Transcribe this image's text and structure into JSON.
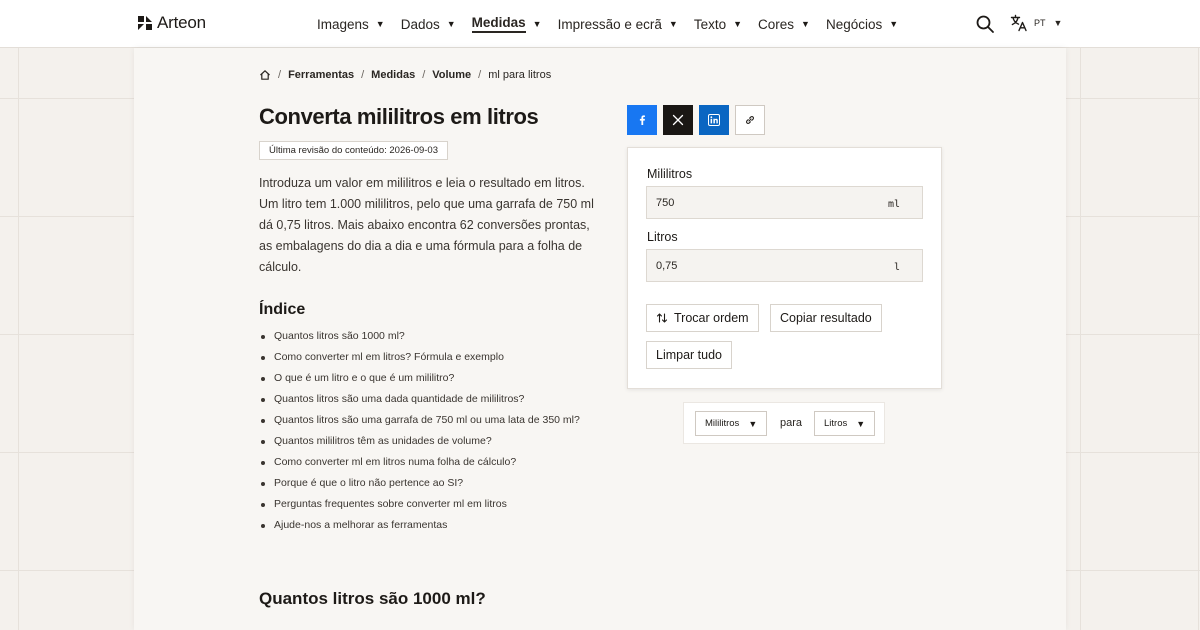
{
  "header": {
    "logo_text": "Arteon",
    "nav": [
      {
        "label": "Imagens",
        "active": false
      },
      {
        "label": "Dados",
        "active": false
      },
      {
        "label": "Medidas",
        "active": true
      },
      {
        "label": "Impressão e ecrã",
        "active": false
      },
      {
        "label": "Texto",
        "active": false
      },
      {
        "label": "Cores",
        "active": false
      },
      {
        "label": "Negócios",
        "active": false
      }
    ],
    "language": "PT",
    "caret": "▼"
  },
  "breadcrumb": {
    "items": [
      "Ferramentas",
      "Medidas",
      "Volume"
    ],
    "current": "ml para litros",
    "separator": "/"
  },
  "article": {
    "title": "Converta mililitros em litros",
    "revision": "Última revisão do conteúdo: 2026-09-03",
    "intro": "Introduza um valor em mililitros e leia o resultado em litros. Um litro tem 1.000 mililitros, pelo que uma garrafa de 750 ml dá 0,75 litros. Mais abaixo encontra 62 conversões prontas, as embalagens do dia a dia e uma fórmula para a folha de cálculo.",
    "toc_title": "Índice",
    "toc": [
      "Quantos litros são 1000 ml?",
      "Como converter ml em litros? Fórmula e exemplo",
      "O que é um litro e o que é um mililitro?",
      "Quantos litros são uma dada quantidade de mililitros?",
      "Quantos litros são uma garrafa de 750 ml ou uma lata de 350 ml?",
      "Quantos mililitros têm as unidades de volume?",
      "Como converter ml em litros numa folha de cálculo?",
      "Porque é que o litro não pertence ao SI?",
      "Perguntas frequentes sobre converter ml em litros",
      "Ajude-nos a melhorar as ferramentas"
    ],
    "section_heading": "Quantos litros são 1000 ml?"
  },
  "converter": {
    "from_label": "Mililitros",
    "from_value": "750",
    "from_unit": "ml",
    "to_label": "Litros",
    "to_value": "0,75",
    "to_unit": "l",
    "swap_label": "Trocar ordem",
    "copy_label": "Copiar resultado",
    "clear_label": "Limpar tudo"
  },
  "unit_selector": {
    "from": "Mililitros",
    "connector": "para",
    "to": "Litros"
  },
  "colors": {
    "facebook": "#1877f2",
    "x": "#1a1714",
    "linkedin": "#0a66c2"
  }
}
